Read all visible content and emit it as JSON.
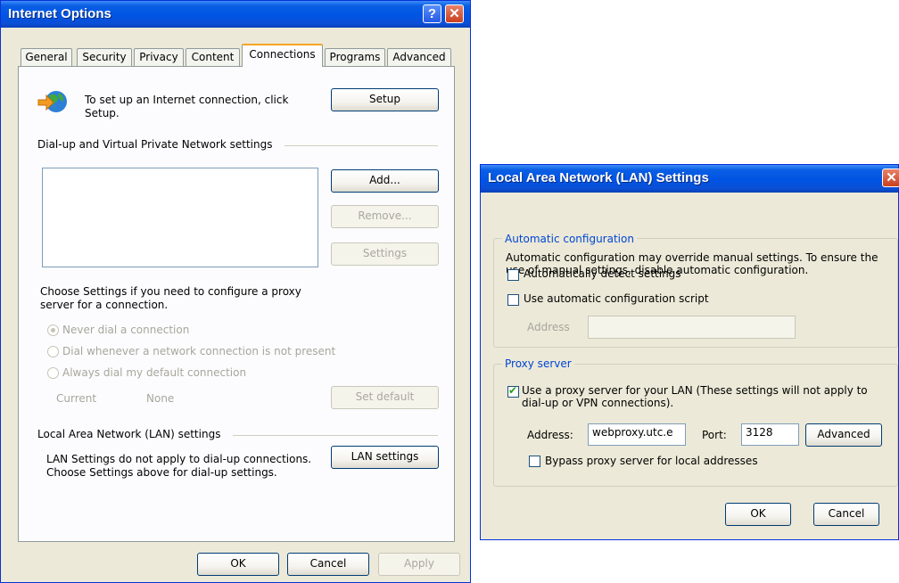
{
  "internet_options": {
    "title": "Internet Options",
    "tabs": [
      "General",
      "Security",
      "Privacy",
      "Content",
      "Connections",
      "Programs",
      "Advanced"
    ],
    "selected_tab": "Connections",
    "setup_text_line1": "To set up an Internet connection, click",
    "setup_text_line2": "Setup.",
    "setup_button": "Setup",
    "dialup_heading": "Dial-up and Virtual Private Network settings",
    "add_button": "Add...",
    "remove_button": "Remove...",
    "settings_button": "Settings",
    "proxy_note_line1": "Choose Settings if you need to configure a proxy",
    "proxy_note_line2": "server for a connection.",
    "radio_options": [
      "Never dial a connection",
      "Dial whenever a network connection is not present",
      "Always dial my default connection"
    ],
    "current_label": "Current",
    "current_value": "None",
    "set_default_button": "Set default",
    "lan_heading": "Local Area Network (LAN) settings",
    "lan_note_line1": "LAN Settings do not apply to dial-up connections.",
    "lan_note_line2": "Choose Settings above for dial-up settings.",
    "lan_settings_button": "LAN settings",
    "ok_button": "OK",
    "cancel_button": "Cancel",
    "apply_button": "Apply"
  },
  "lan_dialog": {
    "title": "Local Area Network (LAN) Settings",
    "auto_group_title": "Automatic configuration",
    "auto_note_line1": "Automatic configuration may override manual settings.  To ensure the",
    "auto_note_line2": "use of manual settings, disable automatic configuration.",
    "auto_detect_label": "Automatically detect settings",
    "auto_script_label": "Use automatic configuration script",
    "script_address_label": "Address",
    "script_address_value": "",
    "proxy_group_title": "Proxy server",
    "use_proxy_line1": "Use a proxy server for your LAN (These settings will not apply to",
    "use_proxy_line2": "dial-up or VPN connections).",
    "use_proxy_checked": true,
    "address_label": "Address:",
    "address_value": "webproxy.utc.e",
    "port_label": "Port:",
    "port_value": "3128",
    "advanced_button": "Advanced",
    "bypass_label": "Bypass proxy server for local addresses",
    "ok_button": "OK",
    "cancel_button": "Cancel"
  },
  "icons": {
    "connection_icon": "globe-with-arrow-icon",
    "help_icon": "question-mark-icon",
    "close_icon": "close-x-icon"
  },
  "colors": {
    "titlebar": "#0054e3",
    "dialog_bg": "#ece9d8",
    "group_title": "#0046d5",
    "selected_tab_accent": "#f5a623"
  }
}
